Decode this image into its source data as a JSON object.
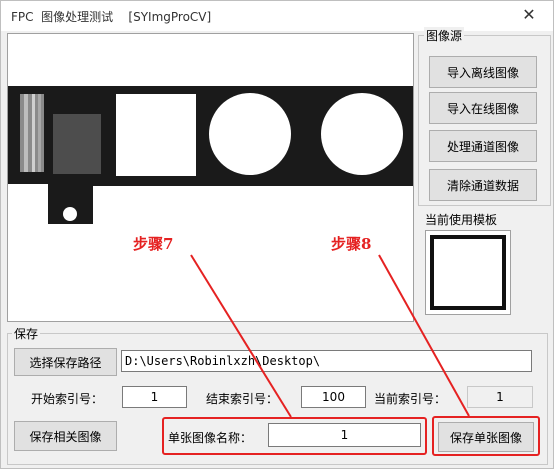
{
  "window": {
    "title": "FPC  图像处理测试    [SYImgProCV]",
    "close_label": "✕"
  },
  "image_source": {
    "group_label": "图像源",
    "buttons": [
      "导入离线图像",
      "导入在线图像",
      "处理通道图像",
      "清除通道数据"
    ]
  },
  "template": {
    "label": "当前使用模板"
  },
  "save": {
    "group_label": "保存",
    "choose_path_button": "选择保存路径",
    "path_value": "D:\\Users\\Robinlxzh\\Desktop\\",
    "start_index_label": "开始索引号：",
    "start_index_value": "1",
    "end_index_label": "结束索引号：",
    "end_index_value": "100",
    "current_index_label": "当前索引号：",
    "current_index_value": "1",
    "save_related_button": "保存相关图像",
    "single_name_label": "单张图像名称：",
    "single_name_value": "1",
    "save_single_button": "保存单张图像"
  },
  "annotations": {
    "step7": "步骤7",
    "step8": "步骤8",
    "color": "#e52222"
  }
}
